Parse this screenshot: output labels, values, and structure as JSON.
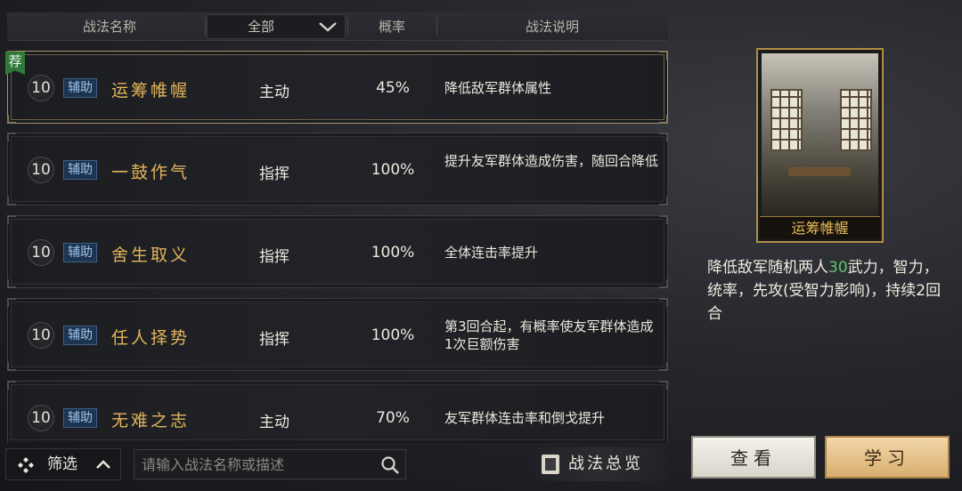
{
  "header": {
    "col_name": "战法名称",
    "filter_value": "全部",
    "col_rate": "概率",
    "col_desc": "战法说明"
  },
  "recommend_tag": "荐",
  "rows": [
    {
      "level": "10",
      "badge": "辅助",
      "name": "运筹帷幄",
      "type": "主动",
      "rate": "45%",
      "desc": "降低敌军群体属性"
    },
    {
      "level": "10",
      "badge": "辅助",
      "name": "一鼓作气",
      "type": "指挥",
      "rate": "100%",
      "desc": "提升友军群体造成伤害，随回合降低"
    },
    {
      "level": "10",
      "badge": "辅助",
      "name": "舍生取义",
      "type": "指挥",
      "rate": "100%",
      "desc": "全体连击率提升"
    },
    {
      "level": "10",
      "badge": "辅助",
      "name": "任人择势",
      "type": "指挥",
      "rate": "100%",
      "desc": "第3回合起，有概率使友军群体造成1次巨额伤害"
    },
    {
      "level": "10",
      "badge": "辅助",
      "name": "无难之志",
      "type": "主动",
      "rate": "70%",
      "desc": "友军群体连击率和倒戈提升"
    }
  ],
  "bottom": {
    "filter_label": "筛选",
    "search_placeholder": "请输入战法名称或描述",
    "overview_label": "战法总览"
  },
  "detail": {
    "card_title": "运筹帷幄",
    "desc_before": "降低敌军随机两人",
    "desc_highlight": "30",
    "desc_after": "武力，智力，统率，先攻(受智力影响)，持续2回合",
    "highlight_color": "#62c46e"
  },
  "buttons": {
    "view": "查看",
    "learn": "学习"
  },
  "icons": {
    "filter": "four-diamonds-icon",
    "expand": "chevron-up-icon",
    "search": "magnifier-icon",
    "overview": "book-icon",
    "dropdown": "chevron-down-icon"
  }
}
